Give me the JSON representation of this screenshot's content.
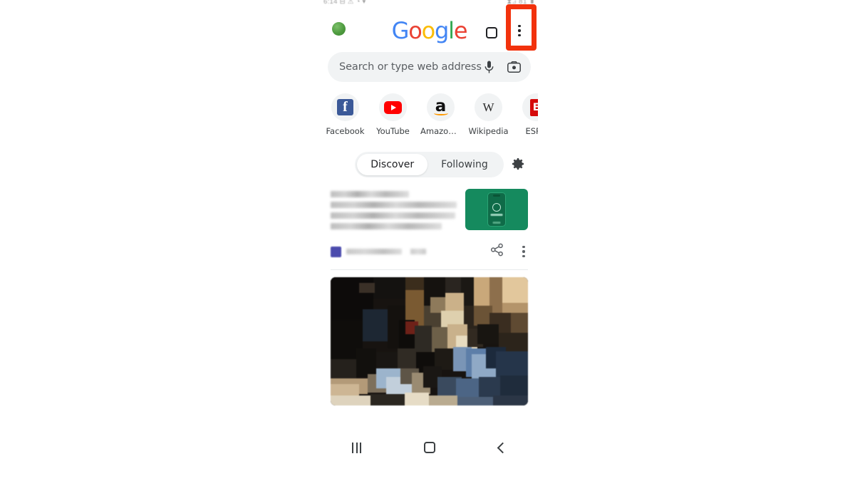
{
  "statusbar": {
    "left": "6:14 ⊟ ⚠ ◔ ▾",
    "right": "⧗⊿ 81 ▮"
  },
  "topbar": {
    "logo": "Google",
    "logo_letters": [
      "G",
      "o",
      "o",
      "g",
      "l",
      "e"
    ],
    "avatar_name": "account-avatar",
    "tab_count": "",
    "menu_icon": "more-vertical-icon"
  },
  "annotation": {
    "color": "#F2320D",
    "target": "chrome-overflow-menu"
  },
  "search": {
    "placeholder": "Search or type web address",
    "mic_icon": "microphone-icon",
    "lens_icon": "camera-lens-icon"
  },
  "shortcuts": [
    {
      "label": "Facebook",
      "icon": "facebook-icon",
      "glyph": "f"
    },
    {
      "label": "YouTube",
      "icon": "youtube-icon",
      "glyph": ""
    },
    {
      "label": "Amazon.c…",
      "icon": "amazon-icon",
      "glyph": "a"
    },
    {
      "label": "Wikipedia",
      "icon": "wikipedia-icon",
      "glyph": "W"
    },
    {
      "label": "ESPN",
      "icon": "espn-icon",
      "glyph": "E"
    }
  ],
  "feed_tabs": {
    "discover": "Discover",
    "following": "Following",
    "settings_icon": "gear-icon",
    "active": "Discover"
  },
  "cards": [
    {
      "type": "article",
      "headline_redacted": true,
      "thumbnail": "green-phone-app-promo",
      "source_redacted": true,
      "share_icon": "share-icon",
      "menu_icon": "more-vertical-icon"
    },
    {
      "type": "photo",
      "image_redacted": true
    }
  ],
  "navbar": {
    "recents": "recents-button",
    "home": "home-button",
    "back": "back-button"
  }
}
